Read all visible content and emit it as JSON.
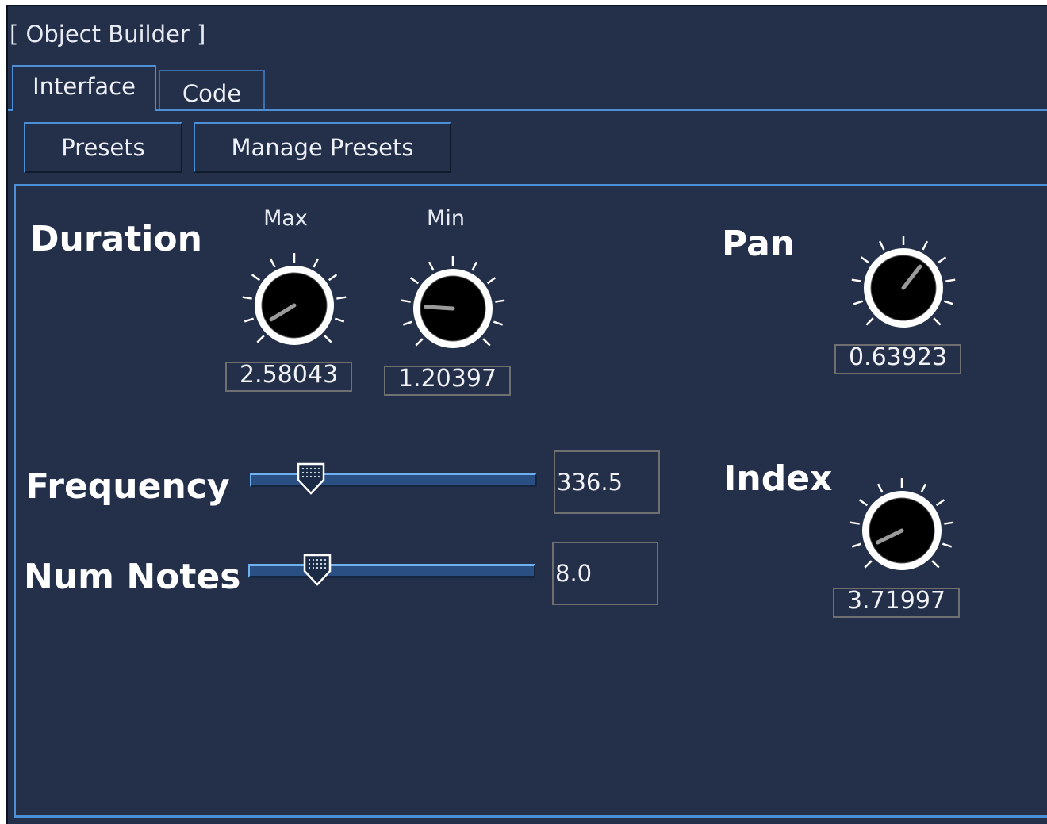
{
  "window": {
    "title": "[ Object Builder ]"
  },
  "tabs": [
    {
      "label": "Interface",
      "active": true
    },
    {
      "label": "Code",
      "active": false
    }
  ],
  "toolbar": {
    "presets_label": "Presets",
    "manage_presets_label": "Manage Presets"
  },
  "duration": {
    "label": "Duration",
    "max": {
      "label": "Max",
      "value": "2.58043",
      "level": 0.05
    },
    "min": {
      "label": "Min",
      "value": "1.20397",
      "level": 0.18
    }
  },
  "pan": {
    "label": "Pan",
    "value": "0.63923",
    "level": 0.64
  },
  "index": {
    "label": "Index",
    "value": "3.71997",
    "level": 0.07
  },
  "frequency": {
    "label": "Frequency",
    "value": "336.5",
    "level": 0.18
  },
  "num_notes": {
    "label": "Num Notes",
    "value": "8.0",
    "level": 0.21
  },
  "colors": {
    "background": "#243049",
    "accent": "#4d8fd6",
    "knob_face": "#000000",
    "knob_ring": "#ffffff",
    "slider_track": "#2a4f82"
  }
}
